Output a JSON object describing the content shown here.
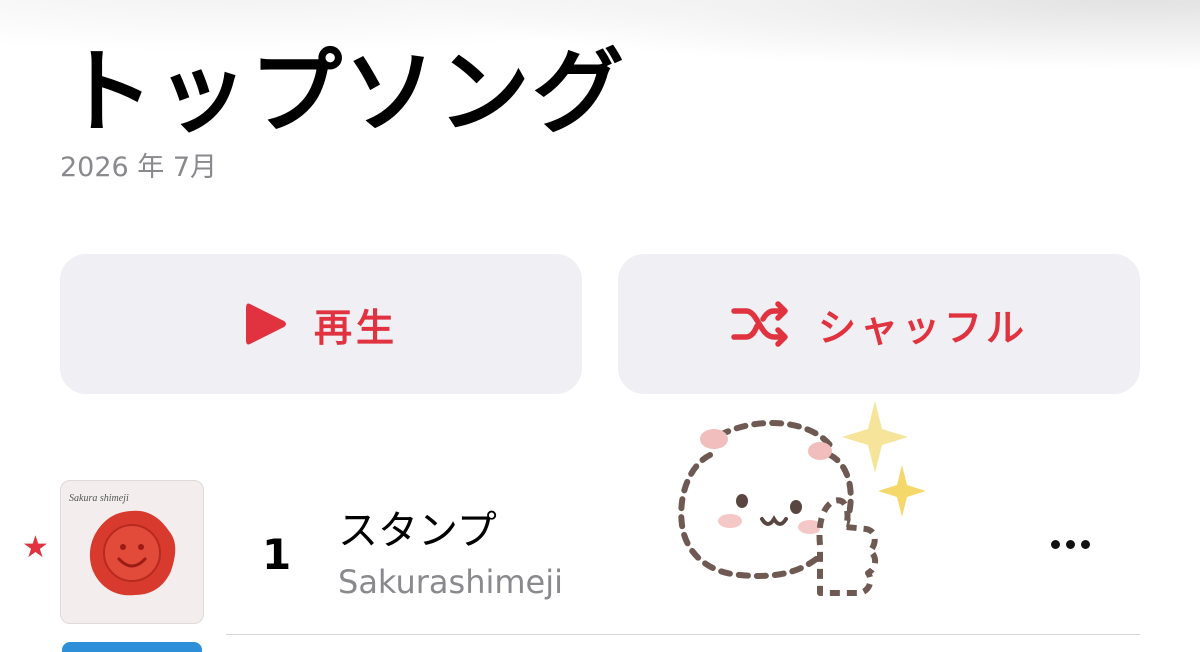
{
  "header": {
    "title": "トップソング",
    "subtitle": "2026 年 7月"
  },
  "actions": {
    "play_label": "再生",
    "play_icon": "play-icon",
    "shuffle_label": "シャッフル",
    "shuffle_icon": "shuffle-icon"
  },
  "colors": {
    "accent": "#e0333f",
    "button_bg": "#efeff4",
    "secondary_text": "#8a8a8e"
  },
  "tracks": [
    {
      "rank": "1",
      "title": "スタンプ",
      "artist": "Sakurashimeji",
      "favorite_icon": "star-icon",
      "more_icon": "ellipsis-icon",
      "artwork_text": "Sakura shimeji"
    }
  ],
  "sticker": "bear-thumbs-up-sticker"
}
